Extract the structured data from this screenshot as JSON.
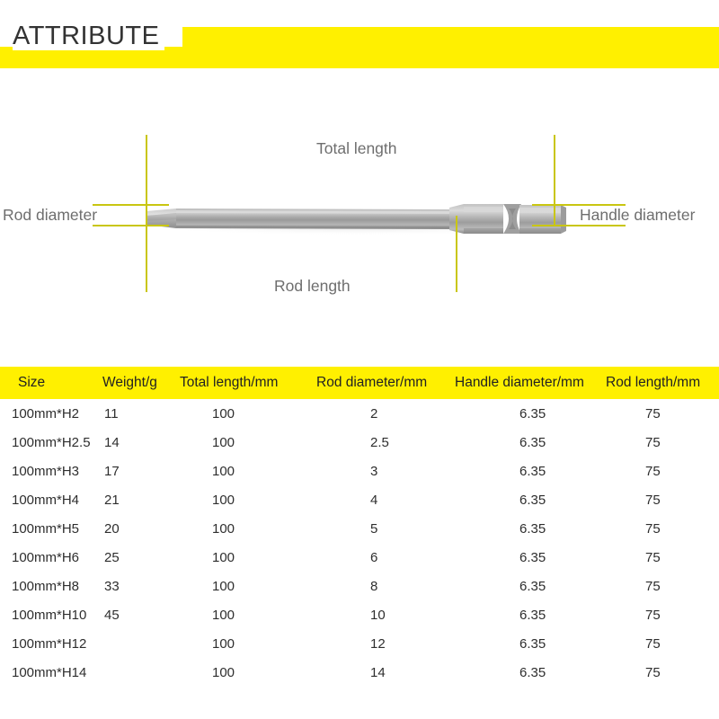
{
  "header": {
    "title": "ATTRIBUTE",
    "band_color": "#fff000"
  },
  "theme": {
    "yellow": "#fff000",
    "annotation_line": "#c9c611",
    "annotation_text": "#6e6e6e",
    "metal_light": "#cfcfcf",
    "metal_mid": "#a8a8a8",
    "metal_dark": "#8d8d8d"
  },
  "diagram": {
    "product": "hex-screwdriver-bit",
    "annotations": [
      {
        "name": "rod-diameter",
        "label": "Rod diameter"
      },
      {
        "name": "total-length",
        "label": "Total length"
      },
      {
        "name": "rod-length",
        "label": "Rod length"
      },
      {
        "name": "handle-diameter",
        "label": "Handle diameter"
      }
    ]
  },
  "table": {
    "columns": [
      "Size",
      "Weight/g",
      "Total length/mm",
      "Rod diameter/mm",
      "Handle diameter/mm",
      "Rod length/mm"
    ],
    "rows": [
      [
        "100mm*H2",
        "11",
        "100",
        "2",
        "6.35",
        "75"
      ],
      [
        "100mm*H2.5",
        "14",
        "100",
        "2.5",
        "6.35",
        "75"
      ],
      [
        "100mm*H3",
        "17",
        "100",
        "3",
        "6.35",
        "75"
      ],
      [
        "100mm*H4",
        "21",
        "100",
        "4",
        "6.35",
        "75"
      ],
      [
        "100mm*H5",
        "20",
        "100",
        "5",
        "6.35",
        "75"
      ],
      [
        "100mm*H6",
        "25",
        "100",
        "6",
        "6.35",
        "75"
      ],
      [
        "100mm*H8",
        "33",
        "100",
        "8",
        "6.35",
        "75"
      ],
      [
        "100mm*H10",
        "45",
        "100",
        "10",
        "6.35",
        "75"
      ],
      [
        "100mm*H12",
        "",
        "100",
        "12",
        "6.35",
        "75"
      ],
      [
        "100mm*H14",
        "",
        "100",
        "14",
        "6.35",
        "75"
      ]
    ]
  }
}
